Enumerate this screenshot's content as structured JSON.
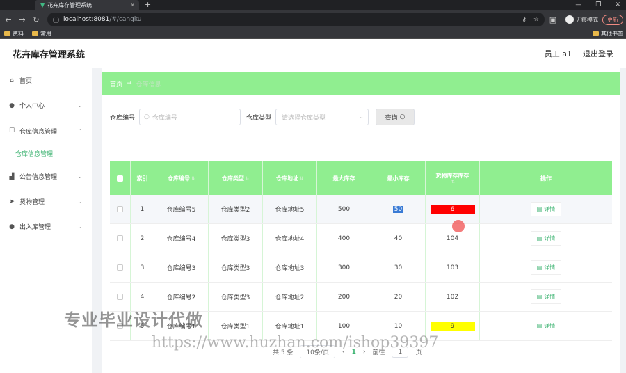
{
  "browser": {
    "tab_title": "花卉库存管理系统",
    "url_host": "localhost:8081",
    "url_path": "/#/cangku",
    "incognito_label": "无痕模式",
    "update_label": "更新",
    "bookmarks": [
      "资料",
      "常用"
    ],
    "bookmarks_right": "其他书签"
  },
  "app": {
    "title": "花卉库存管理系统",
    "user": "员工 a1",
    "logout": "退出登录"
  },
  "sidebar": {
    "items": [
      {
        "label": "首页",
        "icon": "home-icon"
      },
      {
        "label": "个人中心",
        "icon": "user-icon"
      },
      {
        "label": "仓库信息管理",
        "icon": "box-icon"
      },
      {
        "label": "公告信息管理",
        "icon": "chart-icon"
      },
      {
        "label": "货物管理",
        "icon": "send-icon"
      },
      {
        "label": "出入库管理",
        "icon": "user-icon"
      }
    ],
    "submenu_active": "仓库信息管理"
  },
  "breadcrumb": {
    "home": "首页",
    "arrow": "→",
    "current": "仓库信息"
  },
  "filters": {
    "code_label": "仓库编号",
    "code_placeholder": "仓库编号",
    "type_label": "仓库类型",
    "type_placeholder": "请选择仓库类型",
    "query_button": "查询"
  },
  "table": {
    "headers": [
      "",
      "索引",
      "仓库编号",
      "仓库类型",
      "仓库地址",
      "最大库存",
      "最小库存",
      "货物库存库存",
      "操作"
    ],
    "rows": [
      {
        "index": "1",
        "code": "仓库编号5",
        "type": "仓库类型2",
        "addr": "仓库地址5",
        "max": "500",
        "min": "50",
        "stock": "6",
        "stock_style": "red",
        "action": "详情"
      },
      {
        "index": "2",
        "code": "仓库编号4",
        "type": "仓库类型3",
        "addr": "仓库地址4",
        "max": "400",
        "min": "40",
        "stock": "104",
        "stock_style": "",
        "action": "详情"
      },
      {
        "index": "3",
        "code": "仓库编号3",
        "type": "仓库类型3",
        "addr": "仓库地址3",
        "max": "300",
        "min": "30",
        "stock": "103",
        "stock_style": "",
        "action": "详情"
      },
      {
        "index": "4",
        "code": "仓库编号2",
        "type": "仓库类型3",
        "addr": "仓库地址2",
        "max": "200",
        "min": "20",
        "stock": "102",
        "stock_style": "",
        "action": "详情"
      },
      {
        "index": "5",
        "code": "仓库编号1",
        "type": "仓库类型1",
        "addr": "仓库地址1",
        "max": "100",
        "min": "10",
        "stock": "9",
        "stock_style": "yellow",
        "action": "详情"
      }
    ]
  },
  "pager": {
    "total": "共 5 条",
    "page_size": "10条/页",
    "current": "1",
    "goto": "前往",
    "goto_value": "1",
    "page_unit": "页"
  },
  "watermark": {
    "line1": "专业毕业设计代做",
    "line2": "https://www.huzhan.com/ishop39397"
  },
  "colors": {
    "accent": "#90ee90",
    "link": "#3cb371",
    "low_stock": "#ff0000",
    "warn_stock": "#ffff00"
  }
}
